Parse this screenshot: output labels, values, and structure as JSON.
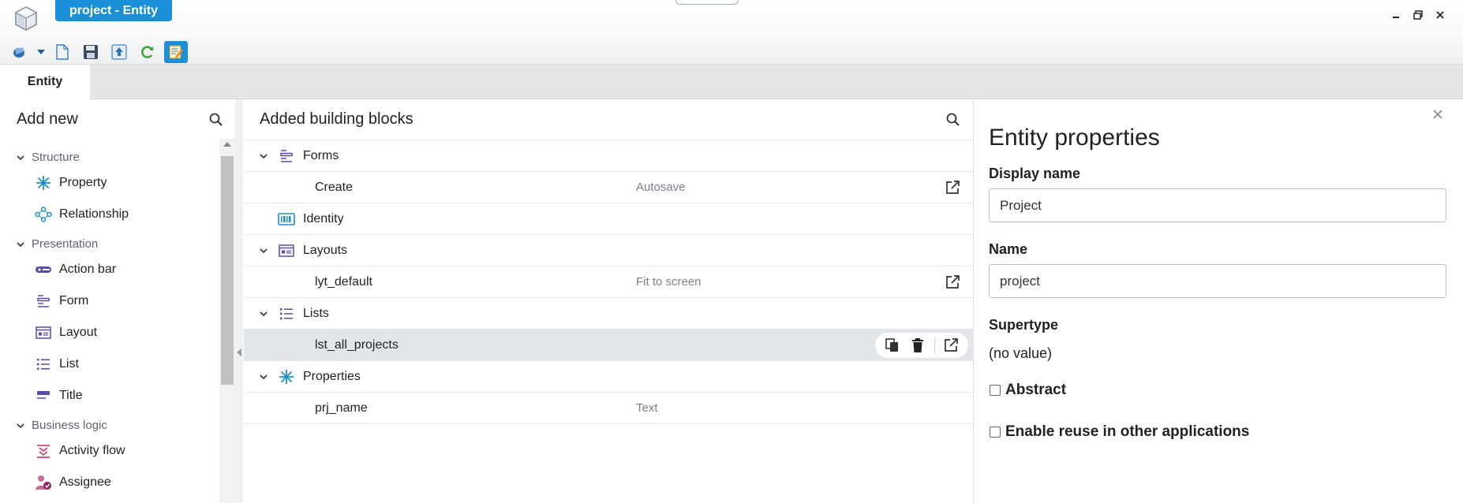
{
  "window": {
    "title": "project - Entity",
    "buttons": [
      {
        "name": "minimize-icon",
        "glyph": "▁"
      },
      {
        "name": "restore-icon",
        "glyph": "❐"
      },
      {
        "name": "close-icon",
        "glyph": "✕"
      }
    ]
  },
  "toolbar": {
    "items": [
      "app-menu-icon",
      "new-document-icon",
      "save-icon",
      "publish-icon",
      "refresh-icon",
      "edit-notes-icon"
    ]
  },
  "tabs": [
    {
      "label": "Entity",
      "active": true
    }
  ],
  "left_panel": {
    "header": "Add new",
    "categories": [
      {
        "label": "Structure",
        "items": [
          {
            "label": "Property",
            "icon": "property-icon"
          },
          {
            "label": "Relationship",
            "icon": "relationship-icon"
          }
        ]
      },
      {
        "label": "Presentation",
        "items": [
          {
            "label": "Action bar",
            "icon": "action-bar-icon"
          },
          {
            "label": "Form",
            "icon": "form-icon"
          },
          {
            "label": "Layout",
            "icon": "layout-icon"
          },
          {
            "label": "List",
            "icon": "list-icon"
          },
          {
            "label": "Title",
            "icon": "title-icon"
          }
        ]
      },
      {
        "label": "Business logic",
        "items": [
          {
            "label": "Activity flow",
            "icon": "activity-flow-icon"
          },
          {
            "label": "Assignee",
            "icon": "assignee-icon"
          }
        ]
      }
    ]
  },
  "middle_panel": {
    "header": "Added building blocks",
    "groups": [
      {
        "label": "Forms",
        "icon": "form-icon",
        "expanded": true,
        "children": [
          {
            "label": "Create",
            "value": "Autosave"
          }
        ]
      },
      {
        "label": "Identity",
        "icon": "identity-icon",
        "expanded": null,
        "children": []
      },
      {
        "label": "Layouts",
        "icon": "layout-icon",
        "expanded": true,
        "children": [
          {
            "label": "lyt_default",
            "value": "Fit to screen"
          }
        ]
      },
      {
        "label": "Lists",
        "icon": "list-icon",
        "expanded": true,
        "children": [
          {
            "label": "lst_all_projects",
            "value": "",
            "selected": true
          }
        ]
      },
      {
        "label": "Properties",
        "icon": "property-icon",
        "expanded": true,
        "children": [
          {
            "label": "prj_name",
            "value": "Text"
          }
        ]
      }
    ]
  },
  "right_panel": {
    "title": "Entity properties",
    "display_name_label": "Display name",
    "display_name_value": "Project",
    "name_label": "Name",
    "name_value": "project",
    "supertype_label": "Supertype",
    "supertype_value": "(no value)",
    "abstract_label": "Abstract",
    "reuse_label": "Enable reuse in other applications"
  },
  "colors": {
    "accent": "#1a90d9",
    "icon_purple": "#5b4aa8",
    "icon_teal": "#1b8fc9",
    "icon_green": "#3aa83a",
    "icon_pink": "#c8307a"
  }
}
